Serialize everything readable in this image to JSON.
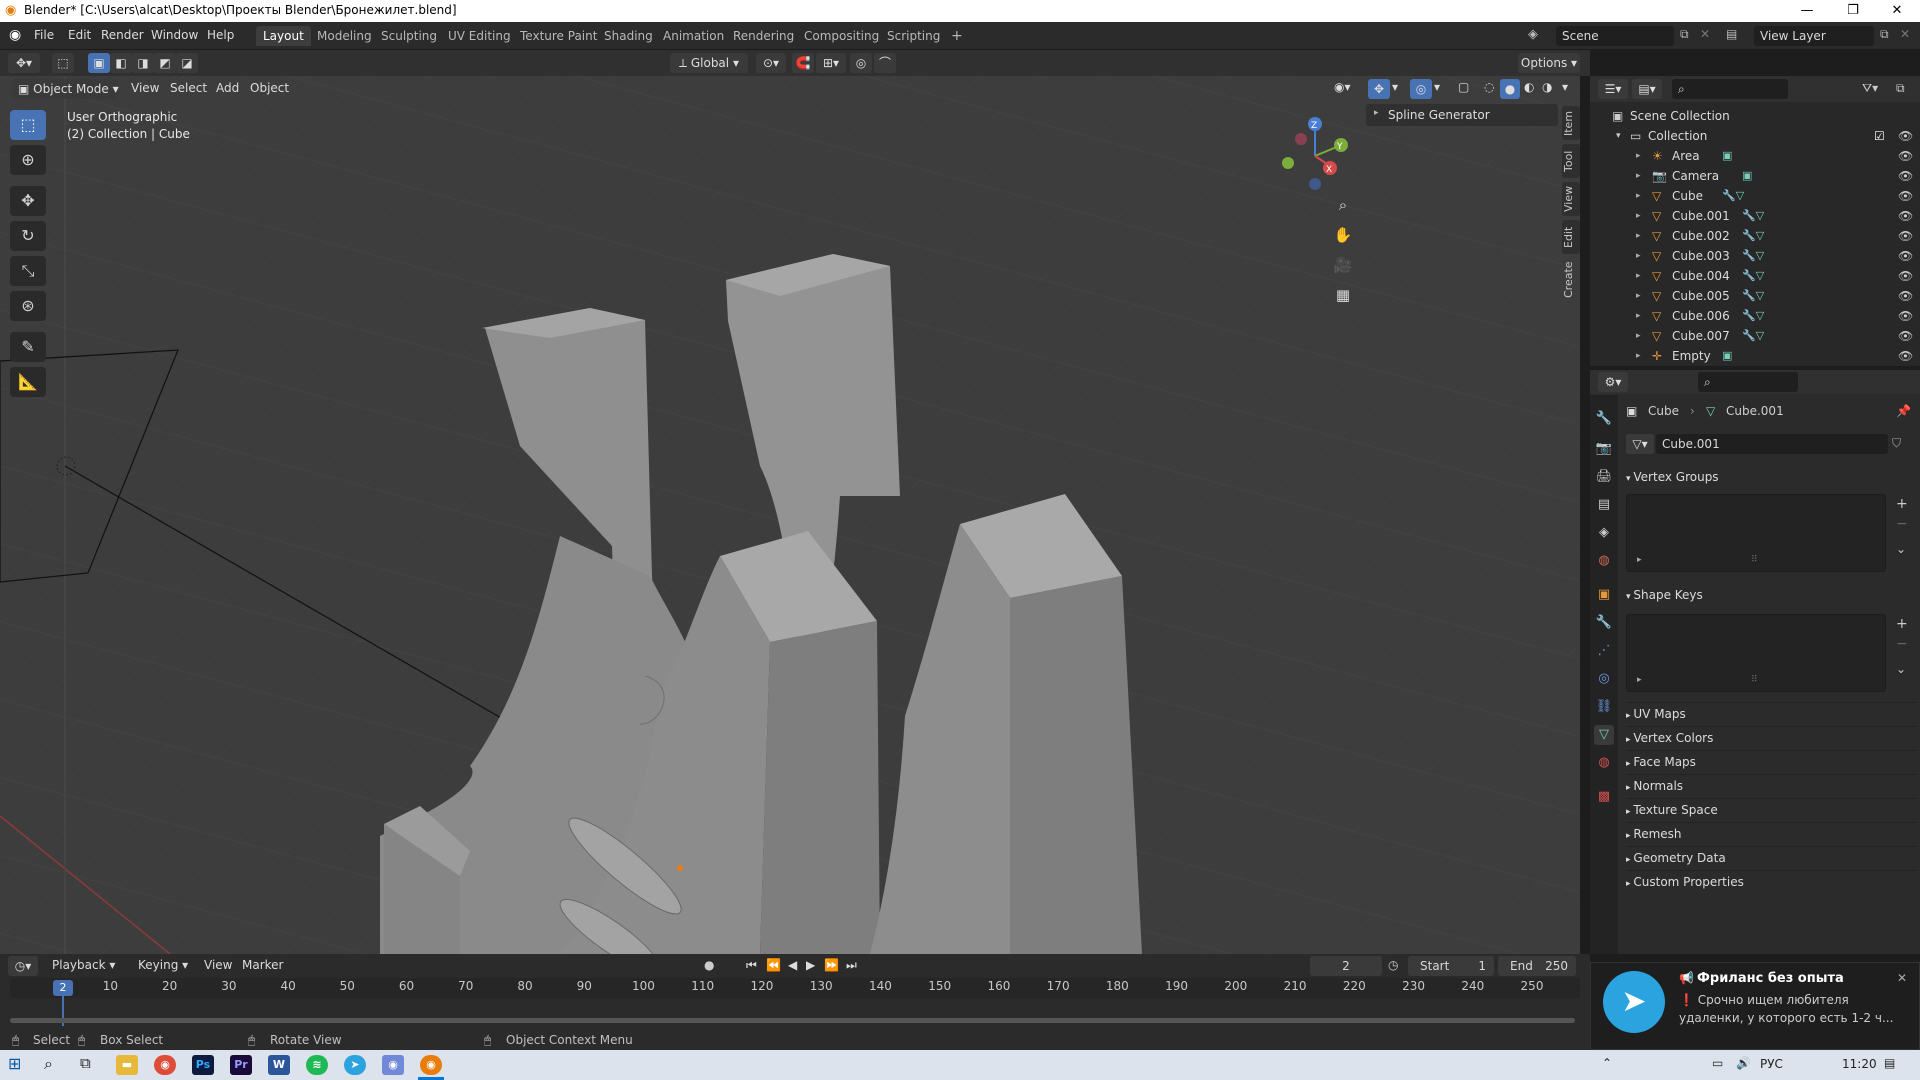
{
  "window": {
    "title": "Blender* [C:\\Users\\alcat\\Desktop\\Проекты Blender\\Бронежилет.blend]",
    "minimize": "—",
    "restore": "❐",
    "close": "✕"
  },
  "menu": [
    "File",
    "Edit",
    "Render",
    "Window",
    "Help"
  ],
  "workspaces": [
    "Layout",
    "Modeling",
    "Sculpting",
    "UV Editing",
    "Texture Paint",
    "Shading",
    "Animation",
    "Rendering",
    "Compositing",
    "Scripting"
  ],
  "active_workspace": "Layout",
  "add_workspace": "+",
  "scene": {
    "label": "Scene",
    "view_layer": "View Layer"
  },
  "toolbar": {
    "transform_orientation": "Global",
    "options": "Options"
  },
  "viewport_header": {
    "mode": "Object Mode",
    "menus": [
      "View",
      "Select",
      "Add",
      "Object"
    ]
  },
  "viewport": {
    "view_name": "User Orthographic",
    "context": "(2) Collection | Cube",
    "npanel_header": "Spline Generator",
    "side_tabs": [
      "Item",
      "Tool",
      "View",
      "Edit",
      "Create"
    ],
    "gizmo": {
      "z": "Z",
      "y": "Y",
      "x": "X"
    }
  },
  "outliner": {
    "root": "Scene Collection",
    "collection": "Collection",
    "items": [
      {
        "name": "Area",
        "icon": "light-icon"
      },
      {
        "name": "Camera",
        "icon": "camera-icon"
      },
      {
        "name": "Cube",
        "icon": "mesh-icon"
      },
      {
        "name": "Cube.001",
        "icon": "mesh-icon"
      },
      {
        "name": "Cube.002",
        "icon": "mesh-icon"
      },
      {
        "name": "Cube.003",
        "icon": "mesh-icon"
      },
      {
        "name": "Cube.004",
        "icon": "mesh-icon"
      },
      {
        "name": "Cube.005",
        "icon": "mesh-icon"
      },
      {
        "name": "Cube.006",
        "icon": "mesh-icon"
      },
      {
        "name": "Cube.007",
        "icon": "mesh-icon"
      },
      {
        "name": "Empty",
        "icon": "empty-icon"
      }
    ]
  },
  "properties": {
    "object": "Cube",
    "data": "Cube.001",
    "mesh_name": "Cube.001",
    "panels": {
      "vertex_groups": "Vertex Groups",
      "shape_keys": "Shape Keys"
    },
    "collapsed": [
      "UV Maps",
      "Vertex Colors",
      "Face Maps",
      "Normals",
      "Texture Space",
      "Remesh",
      "Geometry Data",
      "Custom Properties"
    ]
  },
  "timeline": {
    "menus": [
      "Playback",
      "Keying",
      "View",
      "Marker"
    ],
    "current_frame": "2",
    "start_label": "Start",
    "start": "1",
    "end_label": "End",
    "end": "250",
    "ruler": [
      "10",
      "20",
      "30",
      "40",
      "50",
      "60",
      "70",
      "80",
      "90",
      "100",
      "110",
      "120",
      "130",
      "140",
      "150",
      "160",
      "170",
      "180",
      "190",
      "200",
      "210",
      "220",
      "230",
      "240",
      "250"
    ],
    "playhead": "2"
  },
  "statusbar": {
    "select": "Select",
    "box_select": "Box Select",
    "rotate_view": "Rotate View",
    "context_menu": "Object Context Menu"
  },
  "notification": {
    "title": "Фриланс без опыта",
    "line1": "❗ Срочно ищем любителя",
    "line2": "удаленки, у которого есть 1-2 ч..."
  },
  "taskbar": {
    "lang": "РУС",
    "time": "11:20"
  },
  "colors": {
    "accent": "#4772b3",
    "selection": "#334d80",
    "viewport_bg": "#3d3d3d",
    "mesh": "#9a9a9a",
    "telegram": "#2aa3de"
  }
}
